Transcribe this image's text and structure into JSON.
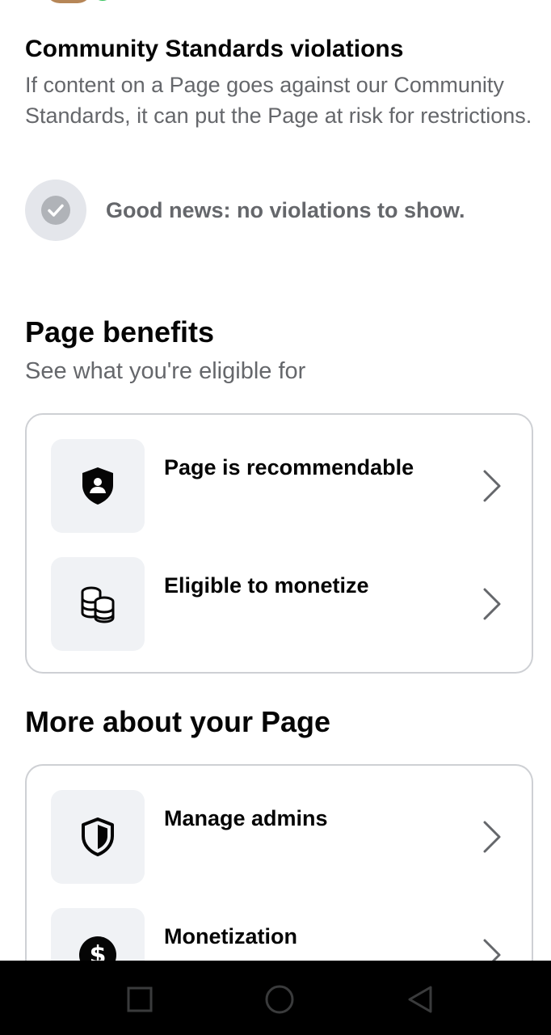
{
  "violations": {
    "title": "Community Standards violations",
    "description": "If content on a Page goes against our Community Standards, it can put the Page at risk for restrictions.",
    "status_text": "Good news: no violations to show.",
    "status_icon": "checkmark-icon"
  },
  "benefits": {
    "title": "Page benefits",
    "subtitle": "See what you're eligible for",
    "items": [
      {
        "label": "Page is recommendable",
        "icon": "shield-person-icon"
      },
      {
        "label": "Eligible to monetize",
        "icon": "coins-icon"
      }
    ]
  },
  "more": {
    "title": "More about your Page",
    "items": [
      {
        "label": "Manage admins",
        "icon": "shield-icon"
      },
      {
        "label": "Monetization",
        "icon": "dollar-icon"
      }
    ]
  },
  "nav": {
    "buttons": [
      "recents-square-icon",
      "home-circle-icon",
      "back-triangle-icon"
    ]
  },
  "colors": {
    "primary_text": "#050505",
    "secondary_text": "#65676b",
    "tile_bg": "#f0f2f5",
    "card_border": "#ced0d4"
  }
}
